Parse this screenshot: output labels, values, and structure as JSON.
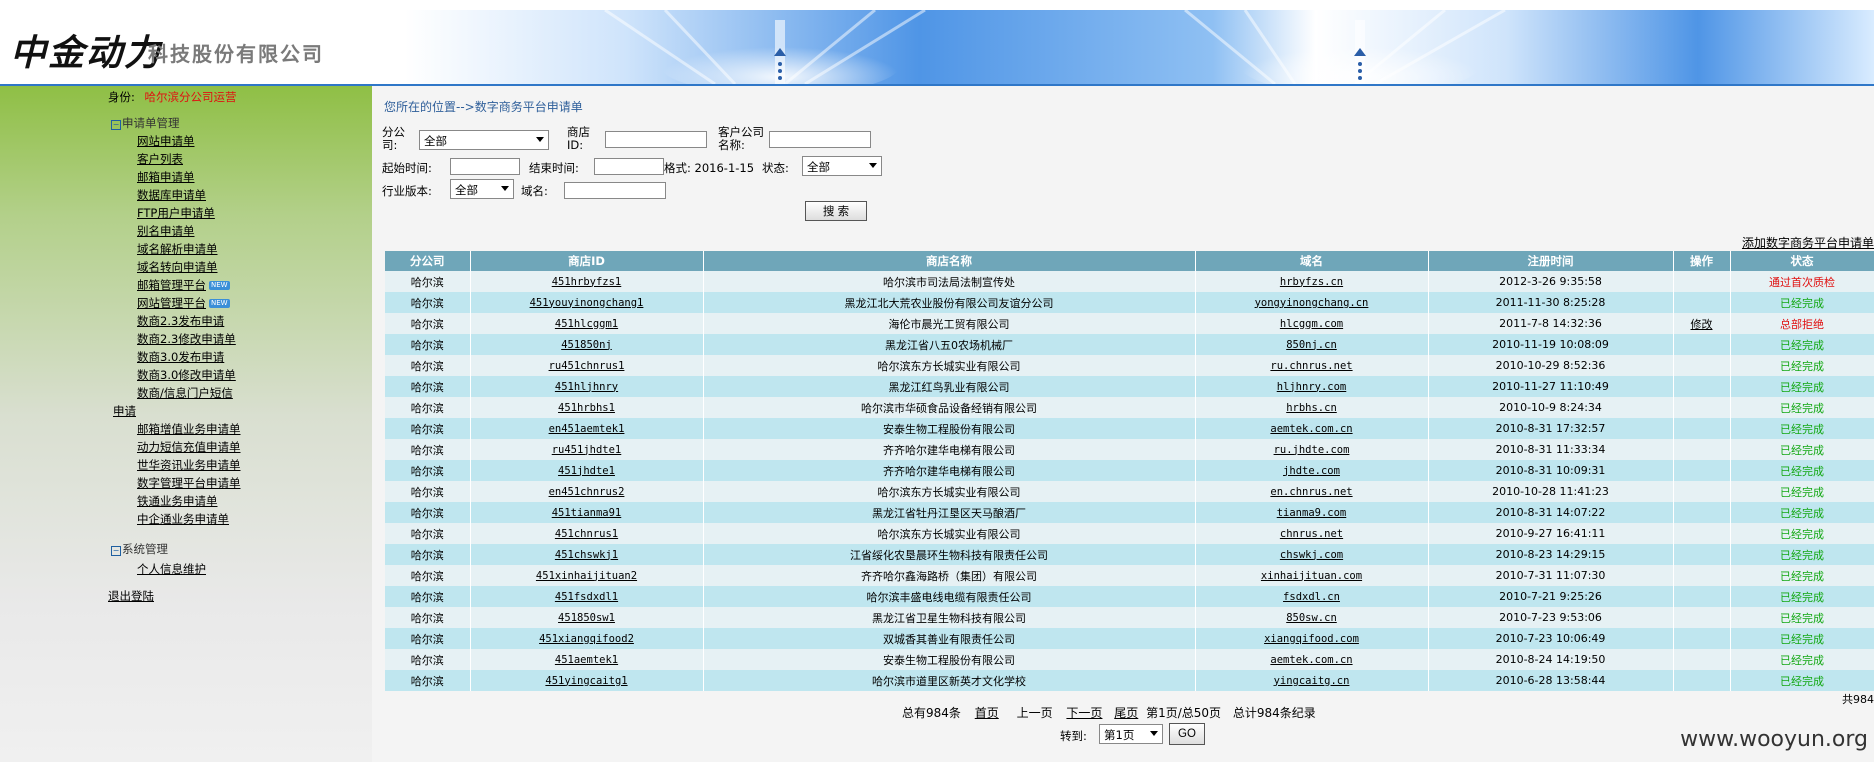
{
  "header": {
    "logo_text": "中金动力",
    "company_name": "科技股份有限公司"
  },
  "sidebar": {
    "identity_label": "身份:",
    "identity_value": "哈尔滨分公司运营",
    "group1_label": "申请单管理",
    "items": [
      "网站申请单",
      "客户列表",
      "邮箱申请单",
      "数据库申请单",
      "FTP用户申请单",
      "别名申请单",
      "域名解析申请单",
      "域名转向申请单",
      "邮箱管理平台",
      "网站管理平台",
      "数商2.3发布申请",
      "数商2.3修改申请单",
      "数商3.0发布申请",
      "数商3.0修改申请单",
      "数商/信息门户短信",
      "申请",
      "邮箱增值业务申请单",
      "动力短信充值申请单",
      "世华资讯业务申请单",
      "数字管理平台申请单",
      "铁通业务申请单",
      "中企通业务申请单"
    ],
    "new_badge": "NEW",
    "group2_label": "系统管理",
    "group2_items": [
      "个人信息维护"
    ],
    "logout": "退出登陆"
  },
  "main": {
    "breadcrumb": "您所在的位置-->数字商务平台申请单",
    "filters": {
      "branch_label_1": "分公",
      "branch_label_2": "司:",
      "branch_value": "全部",
      "store_id_label_1": "商店",
      "store_id_label_2": "ID:",
      "customer_label_1": "客户公司",
      "customer_label_2": "名称:",
      "start_label": "起始时间:",
      "end_label": "结束时间:",
      "format_hint": "格式: 2016-1-15",
      "status_label": "状态:",
      "status_value": "全部",
      "industry_label": "行业版本:",
      "industry_value": "全部",
      "domain_label": "域名:",
      "search_button": "搜 索"
    },
    "add_link": "添加数字商务平台申请单",
    "columns": [
      "分公司",
      "商店ID",
      "商店名称",
      "域名",
      "注册时间",
      "操作",
      "状态"
    ],
    "rows": [
      [
        "哈尔滨",
        "451hrbyfzs1",
        "哈尔滨市司法局法制宣传处",
        "hrbyfzs.cn",
        "2012-3-26 9:35:58",
        "",
        "通过首次质检"
      ],
      [
        "哈尔滨",
        "451youyinongchang1",
        "黑龙江北大荒农业股份有限公司友谊分公司",
        "yongyinongchang.cn",
        "2011-11-30 8:25:28",
        "",
        "已经完成"
      ],
      [
        "哈尔滨",
        "451hlcggm1",
        "海伦市晨光工贸有限公司",
        "hlcggm.com",
        "2011-7-8 14:32:36",
        "修改",
        "总部拒绝"
      ],
      [
        "哈尔滨",
        "451850nj",
        "黑龙江省八五0农场机械厂",
        "850nj.cn",
        "2010-11-19 10:08:09",
        "",
        "已经完成"
      ],
      [
        "哈尔滨",
        "ru451chnrus1",
        "哈尔滨东方长城实业有限公司",
        "ru.chnrus.net",
        "2010-10-29 8:52:36",
        "",
        "已经完成"
      ],
      [
        "哈尔滨",
        "451hljhnry",
        "黑龙江红鸟乳业有限公司",
        "hljhnry.com",
        "2010-11-27 11:10:49",
        "",
        "已经完成"
      ],
      [
        "哈尔滨",
        "451hrbhs1",
        "哈尔滨市华硕食品设备经销有限公司",
        "hrbhs.cn",
        "2010-10-9 8:24:34",
        "",
        "已经完成"
      ],
      [
        "哈尔滨",
        "en451aemtek1",
        "安泰生物工程股份有限公司",
        "aemtek.com.cn",
        "2010-8-31 17:32:57",
        "",
        "已经完成"
      ],
      [
        "哈尔滨",
        "ru451jhdte1",
        "齐齐哈尔建华电梯有限公司",
        "ru.jhdte.com",
        "2010-8-31 11:33:34",
        "",
        "已经完成"
      ],
      [
        "哈尔滨",
        "451jhdte1",
        "齐齐哈尔建华电梯有限公司",
        "jhdte.com",
        "2010-8-31 10:09:31",
        "",
        "已经完成"
      ],
      [
        "哈尔滨",
        "en451chnrus2",
        "哈尔滨东方长城实业有限公司",
        "en.chnrus.net",
        "2010-10-28 11:41:23",
        "",
        "已经完成"
      ],
      [
        "哈尔滨",
        "451tianma91",
        "黑龙江省牡丹江垦区天马酿酒厂",
        "tianma9.com",
        "2010-8-31 14:07:22",
        "",
        "已经完成"
      ],
      [
        "哈尔滨",
        "451chnrus1",
        "哈尔滨东方长城实业有限公司",
        "chnrus.net",
        "2010-9-27 16:41:11",
        "",
        "已经完成"
      ],
      [
        "哈尔滨",
        "451chswkj1",
        "江省绥化农垦晨环生物科技有限责任公司",
        "chswkj.com",
        "2010-8-23 14:29:15",
        "",
        "已经完成"
      ],
      [
        "哈尔滨",
        "451xinhaijituan2",
        "齐齐哈尔鑫海路桥（集团）有限公司",
        "xinhaijituan.com",
        "2010-7-31 11:07:30",
        "",
        "已经完成"
      ],
      [
        "哈尔滨",
        "451fsdxdl1",
        "哈尔滨丰盛电线电缆有限责任公司",
        "fsdxdl.cn",
        "2010-7-21 9:25:26",
        "",
        "已经完成"
      ],
      [
        "哈尔滨",
        "451850sw1",
        "黑龙江省卫星生物科技有限公司",
        "850sw.cn",
        "2010-7-23 9:53:06",
        "",
        "已经完成"
      ],
      [
        "哈尔滨",
        "451xiangqifood2",
        "双城香其善业有限责任公司",
        "xiangqifood.com",
        "2010-7-23 10:06:49",
        "",
        "已经完成"
      ],
      [
        "哈尔滨",
        "451aemtek1",
        "安泰生物工程股份有限公司",
        "aemtek.com.cn",
        "2010-8-24 14:19:50",
        "",
        "已经完成"
      ],
      [
        "哈尔滨",
        "451yingcaitg1",
        "哈尔滨市道里区新英才文化学校",
        "yingcaitg.cn",
        "2010-6-28 13:58:44",
        "",
        "已经完成"
      ]
    ],
    "total_right": "共984",
    "pager": {
      "total": "总有984条",
      "first": "首页",
      "prev": "上一页",
      "next": "下一页",
      "last": "尾页",
      "page_info": "第1页/总50页",
      "count_info": "总计984条纪录",
      "goto_label": "转到:",
      "goto_value": "第1页",
      "go_button": "GO"
    }
  },
  "watermark": "www.wooyun.org"
}
